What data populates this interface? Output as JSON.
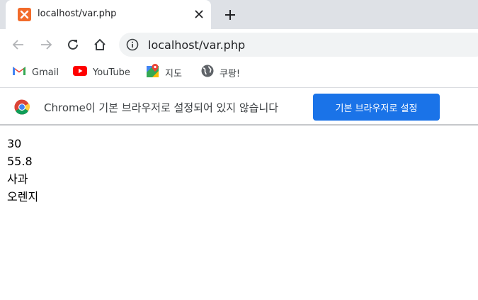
{
  "tab": {
    "title": "localhost/var.php",
    "favicon": "xampp-icon",
    "close_icon": "close-icon"
  },
  "new_tab": {
    "icon": "plus-icon"
  },
  "toolbar": {
    "back_icon": "arrow-left-icon",
    "forward_icon": "arrow-right-icon",
    "reload_icon": "reload-icon",
    "home_icon": "home-icon",
    "url": "localhost/var.php",
    "info_icon": "info-icon"
  },
  "bookmarks": [
    {
      "label": "Gmail",
      "icon": "gmail-icon"
    },
    {
      "label": "YouTube",
      "icon": "youtube-icon"
    },
    {
      "label": "지도",
      "icon": "maps-icon"
    },
    {
      "label": "쿠팡!",
      "icon": "globe-icon"
    }
  ],
  "infobar": {
    "icon": "chrome-logo-icon",
    "message": "Chrome이 기본 브라우저로 설정되어 있지 않습니다",
    "button_label": "기본 브라우저로 설정",
    "button_color": "#1a73e8"
  },
  "output": {
    "lines": [
      "30",
      "55.8",
      "사과",
      "오렌지"
    ]
  },
  "colors": {
    "tabstrip": "#dee1e6",
    "omnibox": "#f1f3f4",
    "accent": "#1a73e8"
  }
}
